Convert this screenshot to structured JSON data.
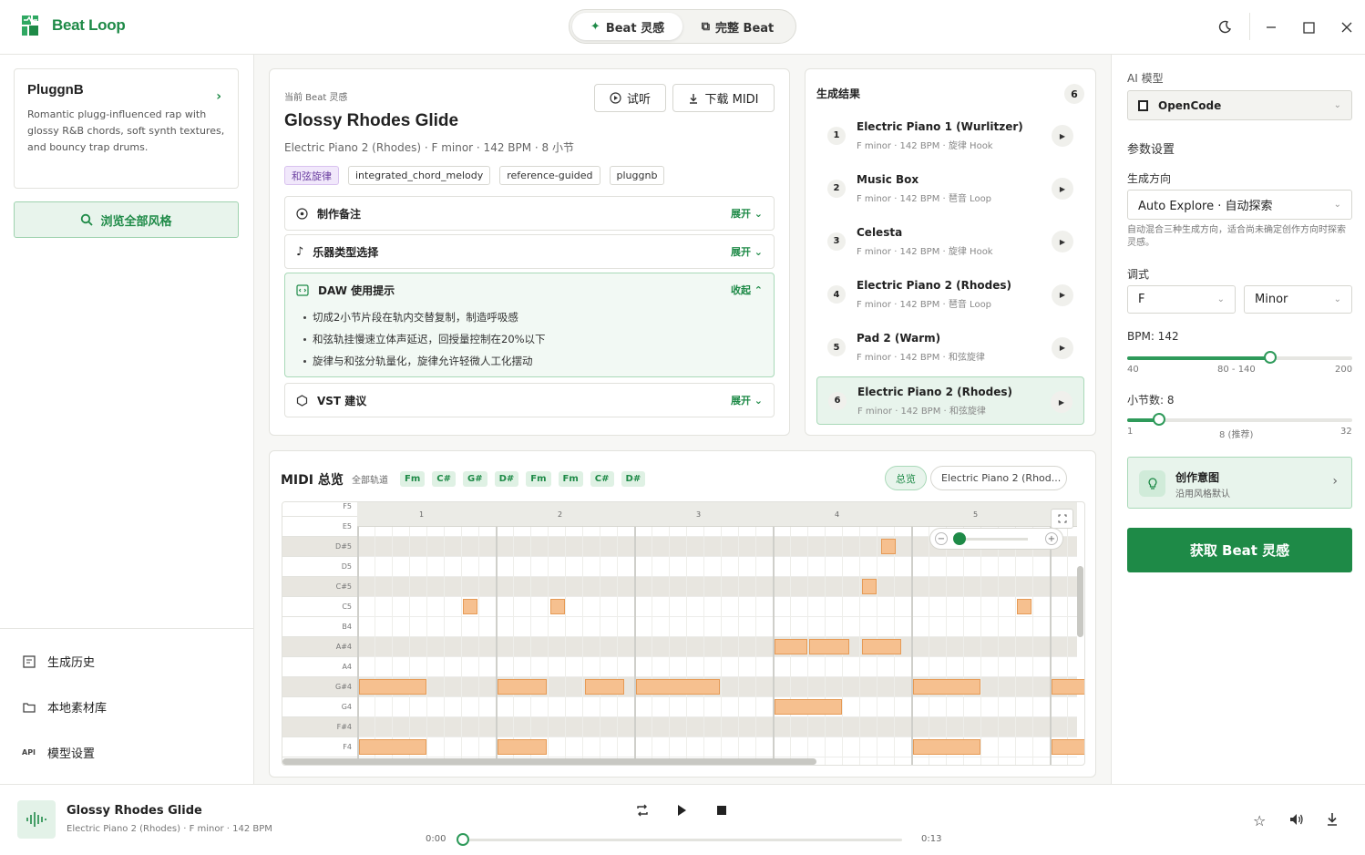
{
  "app": {
    "name": "Beat Loop"
  },
  "modes": [
    {
      "label": "Beat 灵感",
      "icon": "sparkle-icon"
    },
    {
      "label": "完整 Beat",
      "icon": "copy-icon"
    }
  ],
  "window": {
    "theme_icon": "moon-icon"
  },
  "sidebar": {
    "style_card": {
      "name": "PluggnB",
      "description": "Romantic plugg-influenced rap with glossy R&B chords, soft synth textures, and bouncy trap drums."
    },
    "browse_label": "浏览全部风格",
    "nav": [
      {
        "label": "生成历史",
        "icon": "history-icon"
      },
      {
        "label": "本地素材库",
        "icon": "folder-icon"
      },
      {
        "label": "模型设置",
        "icon": "api-icon",
        "badge": "API"
      }
    ]
  },
  "current": {
    "kicker": "当前 Beat 灵感",
    "title": "Glossy Rhodes Glide",
    "meta": "Electric Piano 2 (Rhodes) · F minor · 142 BPM · 8 小节",
    "preview_label": "试听",
    "download_label": "下载 MIDI",
    "tags": [
      "和弦旋律",
      "integrated_chord_melody",
      "reference-guided",
      "pluggnb"
    ],
    "sections": [
      {
        "title": "制作备注",
        "toggle": "展开",
        "icon": "target-icon"
      },
      {
        "title": "乐器类型选择",
        "toggle": "展开",
        "icon": "music-note-icon"
      },
      {
        "title": "DAW 使用提示",
        "toggle": "收起",
        "icon": "code-window-icon",
        "items": [
          "切成2小节片段在轨内交替复制，制造呼吸感",
          "和弦轨挂慢速立体声延迟，回授量控制在20%以下",
          "旋律与和弦分轨量化，旋律允许轻微人工化摆动"
        ]
      },
      {
        "title": "VST 建议",
        "toggle": "展开",
        "icon": "hexagon-icon"
      }
    ]
  },
  "results": {
    "title": "生成结果",
    "count": "6",
    "items": [
      {
        "num": "1",
        "name": "Electric Piano 1 (Wurlitzer)",
        "meta": "F minor · 142 BPM · 旋律 Hook"
      },
      {
        "num": "2",
        "name": "Music Box",
        "meta": "F minor · 142 BPM · 琶音 Loop"
      },
      {
        "num": "3",
        "name": "Celesta",
        "meta": "F minor · 142 BPM · 旋律 Hook"
      },
      {
        "num": "4",
        "name": "Electric Piano 2 (Rhodes)",
        "meta": "F minor · 142 BPM · 琶音 Loop"
      },
      {
        "num": "5",
        "name": "Pad 2 (Warm)",
        "meta": "F minor · 142 BPM · 和弦旋律"
      },
      {
        "num": "6",
        "name": "Electric Piano 2 (Rhodes)",
        "meta": "F minor · 142 BPM · 和弦旋律"
      }
    ]
  },
  "midi": {
    "title": "MIDI 总览",
    "all_tracks": "全部轨道",
    "chords": [
      "Fm",
      "C#",
      "G#",
      "D#",
      "Fm",
      "Fm",
      "C#",
      "D#"
    ],
    "overview_label": "总览",
    "track_select": "Electric Piano 2 (Rhod...",
    "bars": [
      "1",
      "2",
      "3",
      "4",
      "5"
    ],
    "pitches": [
      "F5",
      "E5",
      "D#5",
      "D5",
      "C#5",
      "C5",
      "B4",
      "A#4",
      "A4",
      "G#4",
      "G4",
      "F#4",
      "F4"
    ],
    "notes": [
      {
        "pitch": "D#5",
        "start": 3.77,
        "len": 0.12
      },
      {
        "pitch": "C#5",
        "start": 3.63,
        "len": 0.12
      },
      {
        "pitch": "C5",
        "start": 0.75,
        "len": 0.12
      },
      {
        "pitch": "C5",
        "start": 1.38,
        "len": 0.12
      },
      {
        "pitch": "C5",
        "start": 4.75,
        "len": 0.12
      },
      {
        "pitch": "A#4",
        "start": 3.0,
        "len": 0.25
      },
      {
        "pitch": "A#4",
        "start": 3.25,
        "len": 0.3
      },
      {
        "pitch": "A#4",
        "start": 3.63,
        "len": 0.3
      },
      {
        "pitch": "G#4",
        "start": 0.0,
        "len": 0.5
      },
      {
        "pitch": "G#4",
        "start": 1.0,
        "len": 0.37
      },
      {
        "pitch": "G#4",
        "start": 1.63,
        "len": 0.3
      },
      {
        "pitch": "G#4",
        "start": 2.0,
        "len": 0.62
      },
      {
        "pitch": "G#4",
        "start": 4.0,
        "len": 0.5
      },
      {
        "pitch": "G#4",
        "start": 5.0,
        "len": 0.3
      },
      {
        "pitch": "G4",
        "start": 3.0,
        "len": 0.5
      },
      {
        "pitch": "F4",
        "start": 0.0,
        "len": 0.5
      },
      {
        "pitch": "F4",
        "start": 1.0,
        "len": 0.37
      },
      {
        "pitch": "F4",
        "start": 4.0,
        "len": 0.5
      },
      {
        "pitch": "F4",
        "start": 5.0,
        "len": 0.3
      }
    ]
  },
  "settings": {
    "model_label": "AI 模型",
    "model": "OpenCode",
    "params_label": "参数设置",
    "direction_label": "生成方向",
    "direction": "Auto Explore · 自动探索",
    "direction_hint": "自动混合三种生成方向，适合尚未确定创作方向时探索灵感。",
    "key_label": "调式",
    "key": "F",
    "scale": "Minor",
    "bpm_label": "BPM: 142",
    "bpm": {
      "min": 40,
      "max": 200,
      "value": 142,
      "min_label": "40",
      "mid_label": "80 - 140",
      "max_label": "200"
    },
    "bars_label": "小节数: 8",
    "bars": {
      "min": 1,
      "max": 32,
      "value": 8,
      "min_label": "1",
      "mid_label": "8 (推荐)",
      "max_label": "32"
    },
    "intent_title": "创作意图",
    "intent_sub": "沿用风格默认",
    "generate_label": "获取 Beat 灵感"
  },
  "player": {
    "title": "Glossy Rhodes Glide",
    "meta": "Electric Piano 2 (Rhodes) · F minor · 142 BPM",
    "time_current": "0:00",
    "time_total": "0:13",
    "progress": 0
  },
  "colors": {
    "accent": "#1e8a47",
    "note": "#f6c08f"
  }
}
